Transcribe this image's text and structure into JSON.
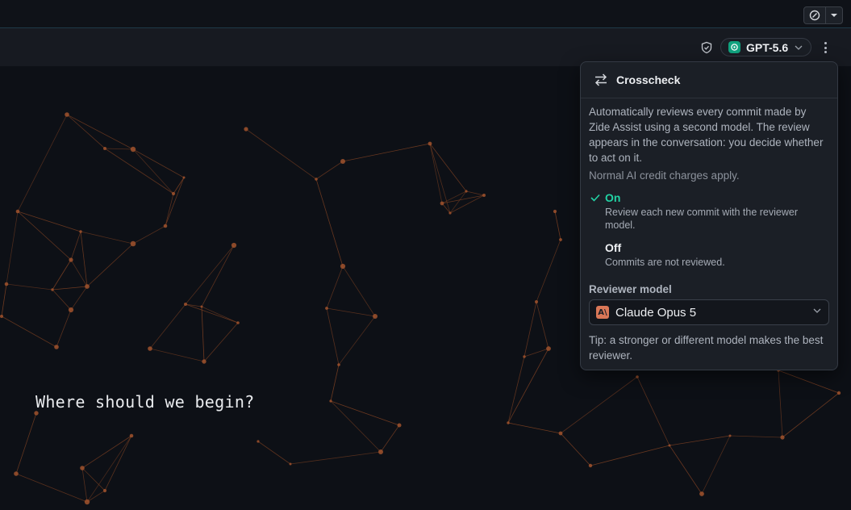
{
  "header": {
    "model_name": "GPT-5.6"
  },
  "main": {
    "prompt_text": "Where should we begin?"
  },
  "popover": {
    "title": "Crosscheck",
    "description": "Automatically reviews every commit made by Zide Assist using a second model. The review appears in the conversation: you decide whether to act on it.",
    "note": "Normal AI credit charges apply.",
    "options": [
      {
        "label": "On",
        "sublabel": "Review each new commit with the reviewer model.",
        "selected": true
      },
      {
        "label": "Off",
        "sublabel": "Commits are not reviewed.",
        "selected": false
      }
    ],
    "reviewer_label": "Reviewer model",
    "reviewer_model": "Claude Opus 5",
    "tip": "Tip: a stronger or different model makes the best reviewer."
  },
  "colors": {
    "accent": "#22d3a4",
    "network_line": "#7a3f22",
    "network_node": "#a0522d",
    "anthropic_logo": "#d97757",
    "openai_badge": "#10a37f"
  },
  "icons": [
    "feedback-icon",
    "dropdown-caret-icon",
    "shield-icon",
    "openai-logo-icon",
    "chevron-down-icon",
    "kebab-menu-icon",
    "swap-arrows-icon",
    "checkmark-icon",
    "anthropic-logo-icon"
  ]
}
